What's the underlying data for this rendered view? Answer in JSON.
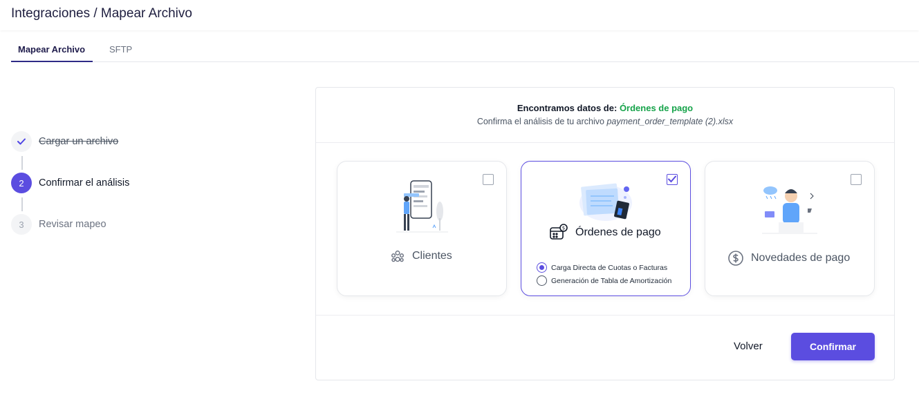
{
  "header": {
    "breadcrumb": "Integraciones / Mapear Archivo"
  },
  "tabs": [
    {
      "label": "Mapear Archivo",
      "active": true
    },
    {
      "label": "SFTP",
      "active": false
    }
  ],
  "steps": [
    {
      "number": "",
      "label": "Cargar un archivo",
      "status": "done"
    },
    {
      "number": "2",
      "label": "Confirmar el análisis",
      "status": "current"
    },
    {
      "number": "3",
      "label": "Revisar mapeo",
      "status": "pending"
    }
  ],
  "panel": {
    "found_prefix": "Encontramos datos de:",
    "found_type": "Órdenes de pago",
    "confirm_prefix": "Confirma el análisis de tu archivo",
    "file_name": "payment_order_template (2).xlsx"
  },
  "cards": [
    {
      "title": "Clientes",
      "checked": false,
      "icon": "users-icon"
    },
    {
      "title": "Órdenes de pago",
      "checked": true,
      "icon": "payment-orders-icon",
      "options": [
        {
          "label": "Carga Directa de Cuotas o Facturas",
          "selected": true
        },
        {
          "label": "Generación de Tabla de Amortización",
          "selected": false
        }
      ]
    },
    {
      "title": "Novedades de pago",
      "checked": false,
      "icon": "dollar-circle-icon"
    }
  ],
  "actions": {
    "back": "Volver",
    "confirm": "Confirmar"
  },
  "colors": {
    "accent": "#5b4de0",
    "success": "#16a34a"
  }
}
